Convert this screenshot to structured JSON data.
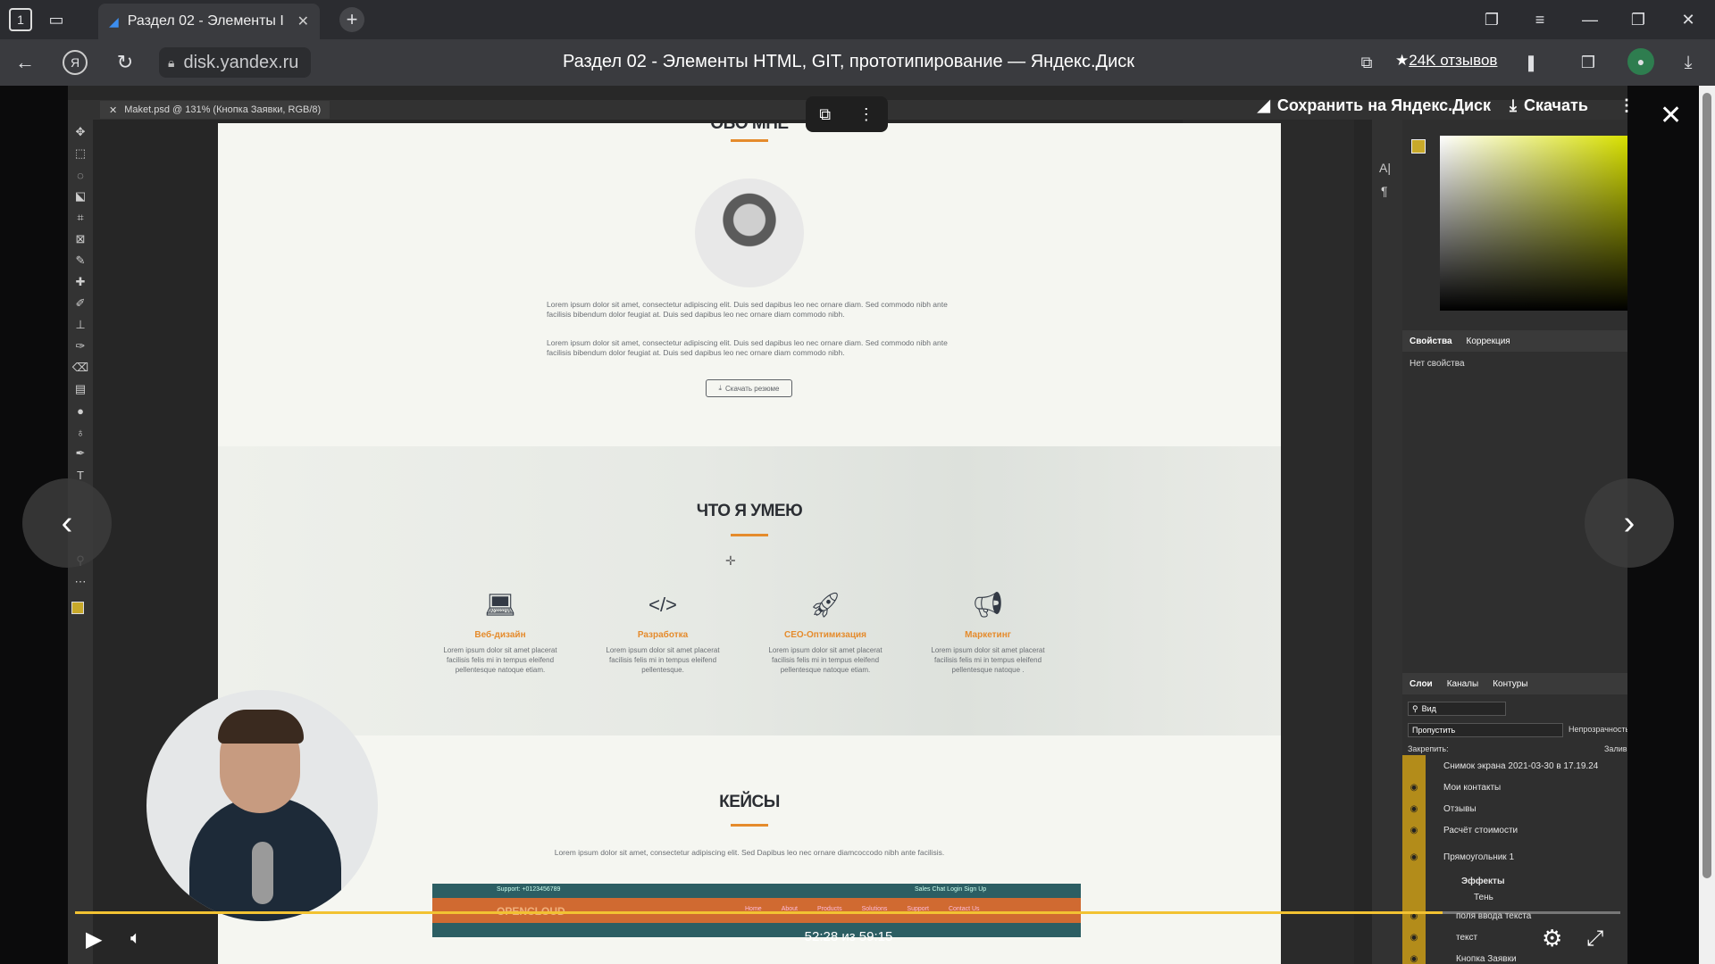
{
  "browser": {
    "tab_count": "1",
    "tab_title": "Раздел 02 - Элементы I",
    "url": "disk.yandex.ru",
    "page_title": "Раздел 02 - Элементы HTML, GIT, прототипирование — Яндекс.Диск",
    "reviews": "24K отзывов",
    "new_tab_icon": "plus-icon"
  },
  "viewer": {
    "save_label": "Сохранить на Яндекс.Диск",
    "download_label": "Скачать",
    "time_label": "52:28 из 59:15",
    "progress": 0.885
  },
  "photoshop": {
    "doc_tab": "Maket.psd @ 131% (Кнопка Заявки, RGB/8)",
    "panel_tabs": [
      "Свойства",
      "Коррекция"
    ],
    "no_properties": "Нет свойства",
    "layers_tabs": [
      "Слои",
      "Каналы",
      "Контуры"
    ],
    "search_kind": "Вид",
    "blend_mode": "Пропустить",
    "opacity_label": "Непрозрачность",
    "lock_label": "Закрепить:",
    "fill_label": "Залив",
    "layers": [
      "Снимок экрана 2021-03-30 в 17.19.24",
      "Мои контакты",
      "Отзывы",
      "Расчёт стоимости",
      "Прямоугольник 1",
      "Эффекты",
      "Тень",
      "поля ввода текста",
      "текст",
      "Кнопка Заявки"
    ]
  },
  "mockup": {
    "about_heading": "ОБО МНЕ",
    "about_text_1": "Lorem ipsum dolor sit amet, consectetur adipiscing elit. Duis sed dapibus leo nec ornare diam. Sed commodo nibh ante facilisis bibendum dolor feugiat at. Duis sed dapibus leo nec ornare diam commodo nibh.",
    "about_text_2": "Lorem ipsum dolor sit amet, consectetur adipiscing elit. Duis sed dapibus leo nec ornare diam. Sed commodo nibh ante facilisis bibendum dolor feugiat at. Duis sed dapibus leo nec ornare diam commodo nibh.",
    "resume_button": "Скачать резюме",
    "skills_heading": "ЧТО Я УМЕЮ",
    "skills": [
      {
        "title": "Веб-дизайн",
        "icon": "laptop-icon",
        "text": "Lorem ipsum dolor sit amet placerat facilisis felis mi in tempus eleifend pellentesque natoque etiam."
      },
      {
        "title": "Разработка",
        "icon": "code-icon",
        "text": "Lorem ipsum dolor sit amet placerat facilisis felis mi in tempus eleifend pellentesque."
      },
      {
        "title": "СЕО-Оптимизация",
        "icon": "rocket-icon",
        "text": "Lorem ipsum dolor sit amet placerat facilisis felis mi in tempus eleifend pellentesque natoque etiam."
      },
      {
        "title": "Маркетинг",
        "icon": "megaphone-icon",
        "text": "Lorem ipsum dolor sit amet placerat facilisis felis mi in tempus eleifend pellentesque natoque ."
      }
    ],
    "cases_heading": "КЕЙСЫ",
    "cases_text": "Lorem ipsum dolor sit amet, consectetur adipiscing elit. Sed Dapibus leo nec ornare diamcoccodo nibh ante facilisis.",
    "case_support": "Support: +0123456789",
    "case_chat": "Sales Chat   Login   Sign Up",
    "case_logo": "OPENCLOUD",
    "case_nav": [
      "Home",
      "About",
      "Products",
      "Solutions",
      "Support",
      "Contact Us"
    ]
  },
  "colors": {
    "accent": "#e58b2c",
    "progress": "#f2c232",
    "layer_highlight": "#b38c1a"
  }
}
